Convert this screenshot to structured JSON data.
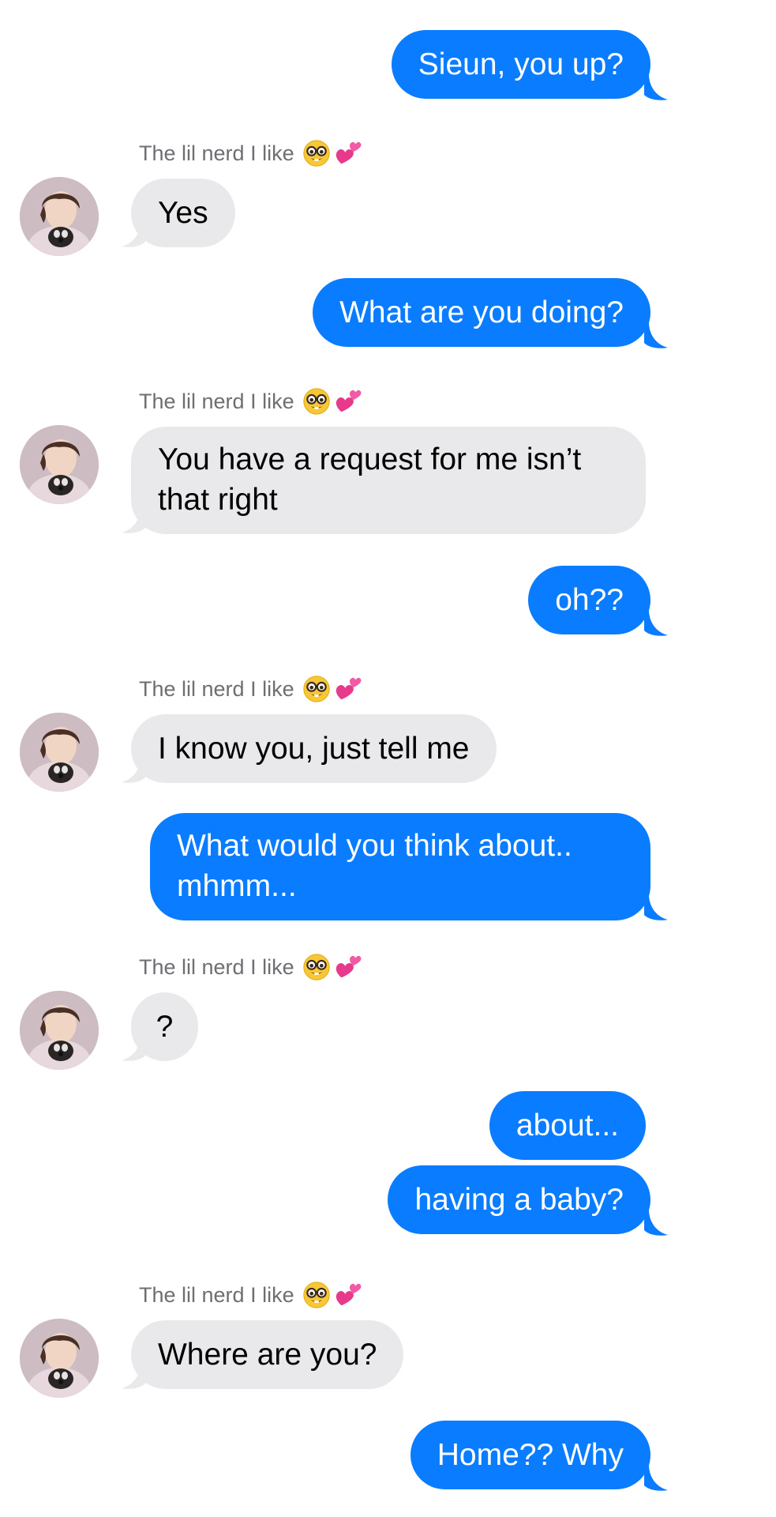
{
  "conversation": {
    "sender_name": "The lil nerd I like",
    "sender_emojis": [
      "nerd-face-icon",
      "two-hearts-icon"
    ],
    "colors": {
      "outgoing_bubble": "#0a7cff",
      "incoming_bubble": "#e9e9eb",
      "outgoing_text": "#ffffff",
      "incoming_text": "#000000",
      "sender_label": "#6e6e73"
    },
    "messages": [
      {
        "direction": "outgoing",
        "text": "Sieun, you up?"
      },
      {
        "direction": "incoming",
        "text": "Yes"
      },
      {
        "direction": "outgoing",
        "text": "What are you doing?"
      },
      {
        "direction": "incoming",
        "line1": "You have a request for me isn’t",
        "line2": "that right"
      },
      {
        "direction": "outgoing",
        "text": "oh??"
      },
      {
        "direction": "incoming",
        "text": "I know you, just tell me"
      },
      {
        "direction": "outgoing",
        "line1": "What would you think about..",
        "line2": "mhmm..."
      },
      {
        "direction": "incoming",
        "text": "?"
      },
      {
        "direction": "outgoing",
        "text": "about..."
      },
      {
        "direction": "outgoing",
        "text": "having a baby?"
      },
      {
        "direction": "incoming",
        "text": "Where are you?"
      },
      {
        "direction": "outgoing",
        "text": "Home?? Why"
      }
    ]
  }
}
